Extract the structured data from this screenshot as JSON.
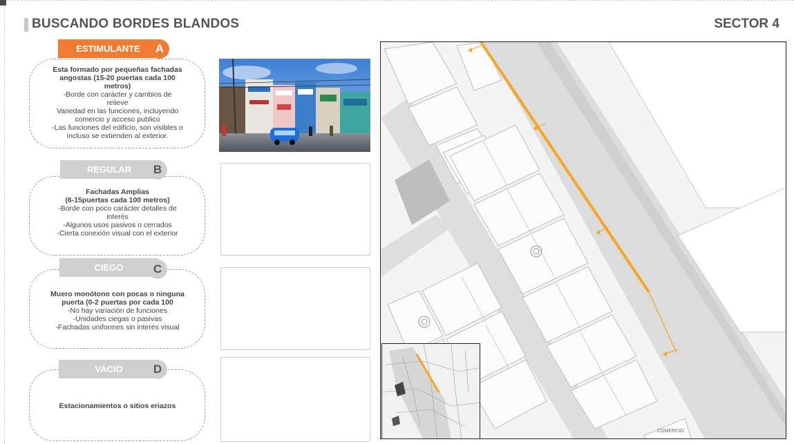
{
  "header": {
    "title": "BUSCANDO BORDES BLANDOS",
    "sector": "SECTOR 4"
  },
  "categories": [
    {
      "name": "ESTIMULANTE",
      "letter": "A",
      "color": "#f07c33",
      "lines": [
        {
          "t": "Esta formado por pequeñas fachadas",
          "b": true
        },
        {
          "t": "angostas (15-20 puertas cada 100",
          "b": true
        },
        {
          "t": "metros)",
          "b": true
        },
        {
          "t": "-Borde con carácter y cambios de",
          "b": false
        },
        {
          "t": "relieve",
          "b": false
        },
        {
          "t": "Variedad en las funciones, incluyendo",
          "b": false
        },
        {
          "t": "comercio y acceso publico",
          "b": false
        },
        {
          "t": "-Las funciones del edificio, son visibles o",
          "b": false
        },
        {
          "t": "incluso se extienden al exterior.",
          "b": false
        }
      ]
    },
    {
      "name": "REGULAR",
      "letter": "B",
      "color": "#cfcfcf",
      "letter_color": "#555555",
      "lines": [
        {
          "t": "Fachadas Amplias",
          "b": true
        },
        {
          "t": "(6-15puertas cada 100 metros)",
          "b": true
        },
        {
          "t": "-Borde con poco carácter detalles de",
          "b": false
        },
        {
          "t": "interés",
          "b": false
        },
        {
          "t": "-Algunos usos pasivos o cerrados",
          "b": false
        },
        {
          "t": "-Cierta conexión visual con el exterior",
          "b": false
        }
      ]
    },
    {
      "name": "CIEGO",
      "letter": "C",
      "color": "#cfcfcf",
      "letter_color": "#555555",
      "lines": [
        {
          "t": "Muero monótono con pocas o ninguna",
          "b": true
        },
        {
          "t": "puerta (0-2 puertas por cada 100",
          "b": true
        },
        {
          "t": "-No hay variación de funciones",
          "b": false
        },
        {
          "t": "-Unidades ciegas o pasivas",
          "b": false
        },
        {
          "t": "-Fachadas uniformes sin interés visual",
          "b": false
        }
      ]
    },
    {
      "name": "VACIO",
      "letter": "D",
      "color": "#cfcfcf",
      "letter_color": "#555555",
      "lines": [
        {
          "t": "Estacionamientos o sitios eriazos",
          "b": true
        }
      ]
    }
  ],
  "map": {
    "highlight_color": "#f5a623",
    "building_label": "COMERCIO"
  }
}
